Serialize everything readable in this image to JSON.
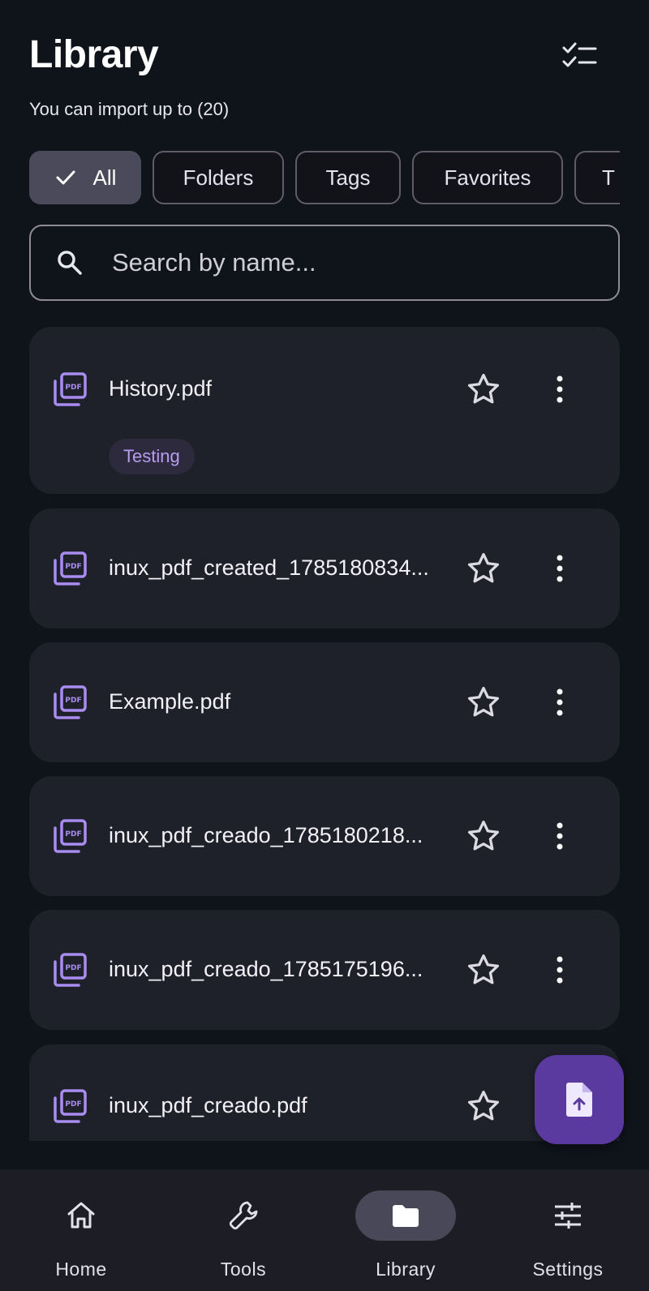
{
  "header": {
    "title": "Library",
    "subtitle": "You can import up to (20)"
  },
  "filters": {
    "chips": [
      "All",
      "Folders",
      "Tags",
      "Favorites",
      "T"
    ],
    "selected": "All"
  },
  "search": {
    "placeholder": "Search by name..."
  },
  "files": [
    {
      "name": "History.pdf",
      "tag": "Testing"
    },
    {
      "name": "inux_pdf_created_1785180834...",
      "tag": ""
    },
    {
      "name": "Example.pdf",
      "tag": ""
    },
    {
      "name": "inux_pdf_creado_1785180218...",
      "tag": ""
    },
    {
      "name": "inux_pdf_creado_1785175196...",
      "tag": ""
    },
    {
      "name": "inux_pdf_creado.pdf",
      "tag": ""
    }
  ],
  "bottom_nav": {
    "items": [
      {
        "label": "Home",
        "icon": "home-icon"
      },
      {
        "label": "Tools",
        "icon": "wrench-icon"
      },
      {
        "label": "Library",
        "icon": "folder-icon"
      },
      {
        "label": "Settings",
        "icon": "sliders-icon"
      }
    ],
    "active": "Library"
  },
  "colors": {
    "background": "#0f131a",
    "card": "#1f212a",
    "accent": "#a98cf0",
    "fab": "#5b3aa0",
    "nav_bar": "#1d1d25"
  }
}
